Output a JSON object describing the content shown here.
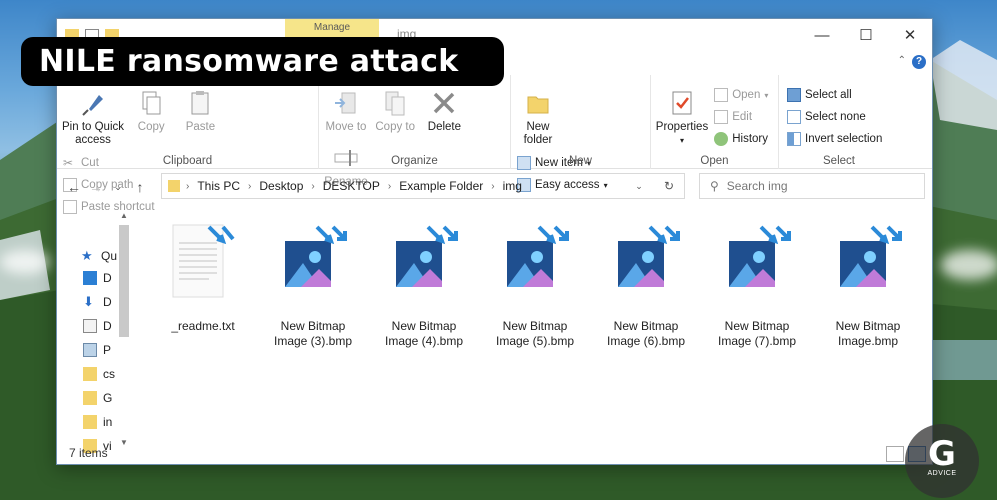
{
  "overlay": {
    "banner_text": "NILE ransomware attack",
    "badge_letter": "G",
    "badge_text": "ADVICE"
  },
  "window": {
    "title": "img",
    "manage_tab": "Manage",
    "controls": {
      "minimize": "—",
      "maximize": "☐",
      "close": "✕"
    },
    "help": "?"
  },
  "ribbon": {
    "clipboard": {
      "label": "Clipboard",
      "pin": "Pin to Quick access",
      "copy": "Copy",
      "paste": "Paste",
      "cut": "Cut",
      "copy_path": "Copy path",
      "paste_shortcut": "Paste shortcut"
    },
    "organize": {
      "label": "Organize",
      "move_to": "Move to",
      "copy_to": "Copy to",
      "delete": "Delete",
      "rename": "Rename"
    },
    "new": {
      "label": "New",
      "new_folder": "New folder",
      "new_item": "New item",
      "easy_access": "Easy access"
    },
    "open": {
      "label": "Open",
      "properties": "Properties",
      "open": "Open",
      "edit": "Edit",
      "history": "History"
    },
    "select": {
      "label": "Select",
      "select_all": "Select all",
      "select_none": "Select none",
      "invert_selection": "Invert selection"
    }
  },
  "address": {
    "crumbs": [
      "This PC",
      "Desktop",
      "DESKTOP",
      "Example Folder",
      "img"
    ],
    "search_placeholder": "Search img"
  },
  "sidebar": {
    "items": [
      "Qu",
      "D",
      "D",
      "D",
      "P",
      "cs",
      "G",
      "in",
      "vi"
    ]
  },
  "files": [
    {
      "name": "_readme.txt",
      "type": "text"
    },
    {
      "name": "New Bitmap Image (3).bmp",
      "type": "bmp"
    },
    {
      "name": "New Bitmap Image (4).bmp",
      "type": "bmp"
    },
    {
      "name": "New Bitmap Image (5).bmp",
      "type": "bmp"
    },
    {
      "name": "New Bitmap Image (6).bmp",
      "type": "bmp"
    },
    {
      "name": "New Bitmap Image (7).bmp",
      "type": "bmp"
    },
    {
      "name": "New Bitmap Image.bmp",
      "type": "bmp"
    }
  ],
  "status": {
    "item_count": "7 items"
  },
  "colors": {
    "accent": "#2b6fc7",
    "manage_tab": "#f6e58a",
    "folder": "#f3d36b"
  }
}
